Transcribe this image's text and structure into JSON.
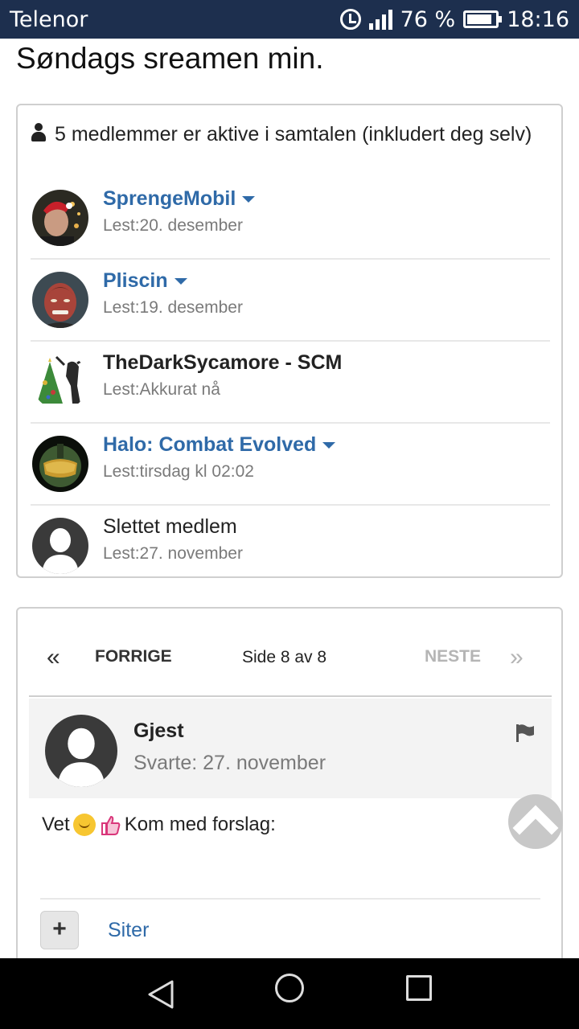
{
  "statusbar": {
    "carrier": "Telenor",
    "battery": "76 %",
    "time": "18:16"
  },
  "page": {
    "title": "Søndags sreamen min."
  },
  "members": {
    "header": "5 medlemmer er aktive i samtalen (inkludert deg selv)",
    "list": [
      {
        "name": "SprengeMobil",
        "read": "Lest:20. desember"
      },
      {
        "name": "Pliscin",
        "read": "Lest:19. desember"
      },
      {
        "name": "TheDarkSycamore - SCM",
        "read": "Lest:Akkurat nå"
      },
      {
        "name": "Halo: Combat Evolved",
        "read": "Lest:tirsdag kl 02:02"
      },
      {
        "name": "Slettet medlem",
        "read": "Lest:27. november"
      }
    ]
  },
  "pager": {
    "prev": "FORRIGE",
    "page": "Side 8 av 8",
    "next": "NESTE"
  },
  "post": {
    "author": "Gjest",
    "replied": "Svarte: 27. november",
    "text_start": "Vet",
    "text_end": "Kom med forslag:",
    "quote": "Siter",
    "plus": "+"
  },
  "icons": {
    "status": [
      "alarm-icon",
      "signal-icon",
      "battery-icon"
    ],
    "nav": [
      "back-icon",
      "home-icon",
      "recent-apps-icon"
    ]
  }
}
